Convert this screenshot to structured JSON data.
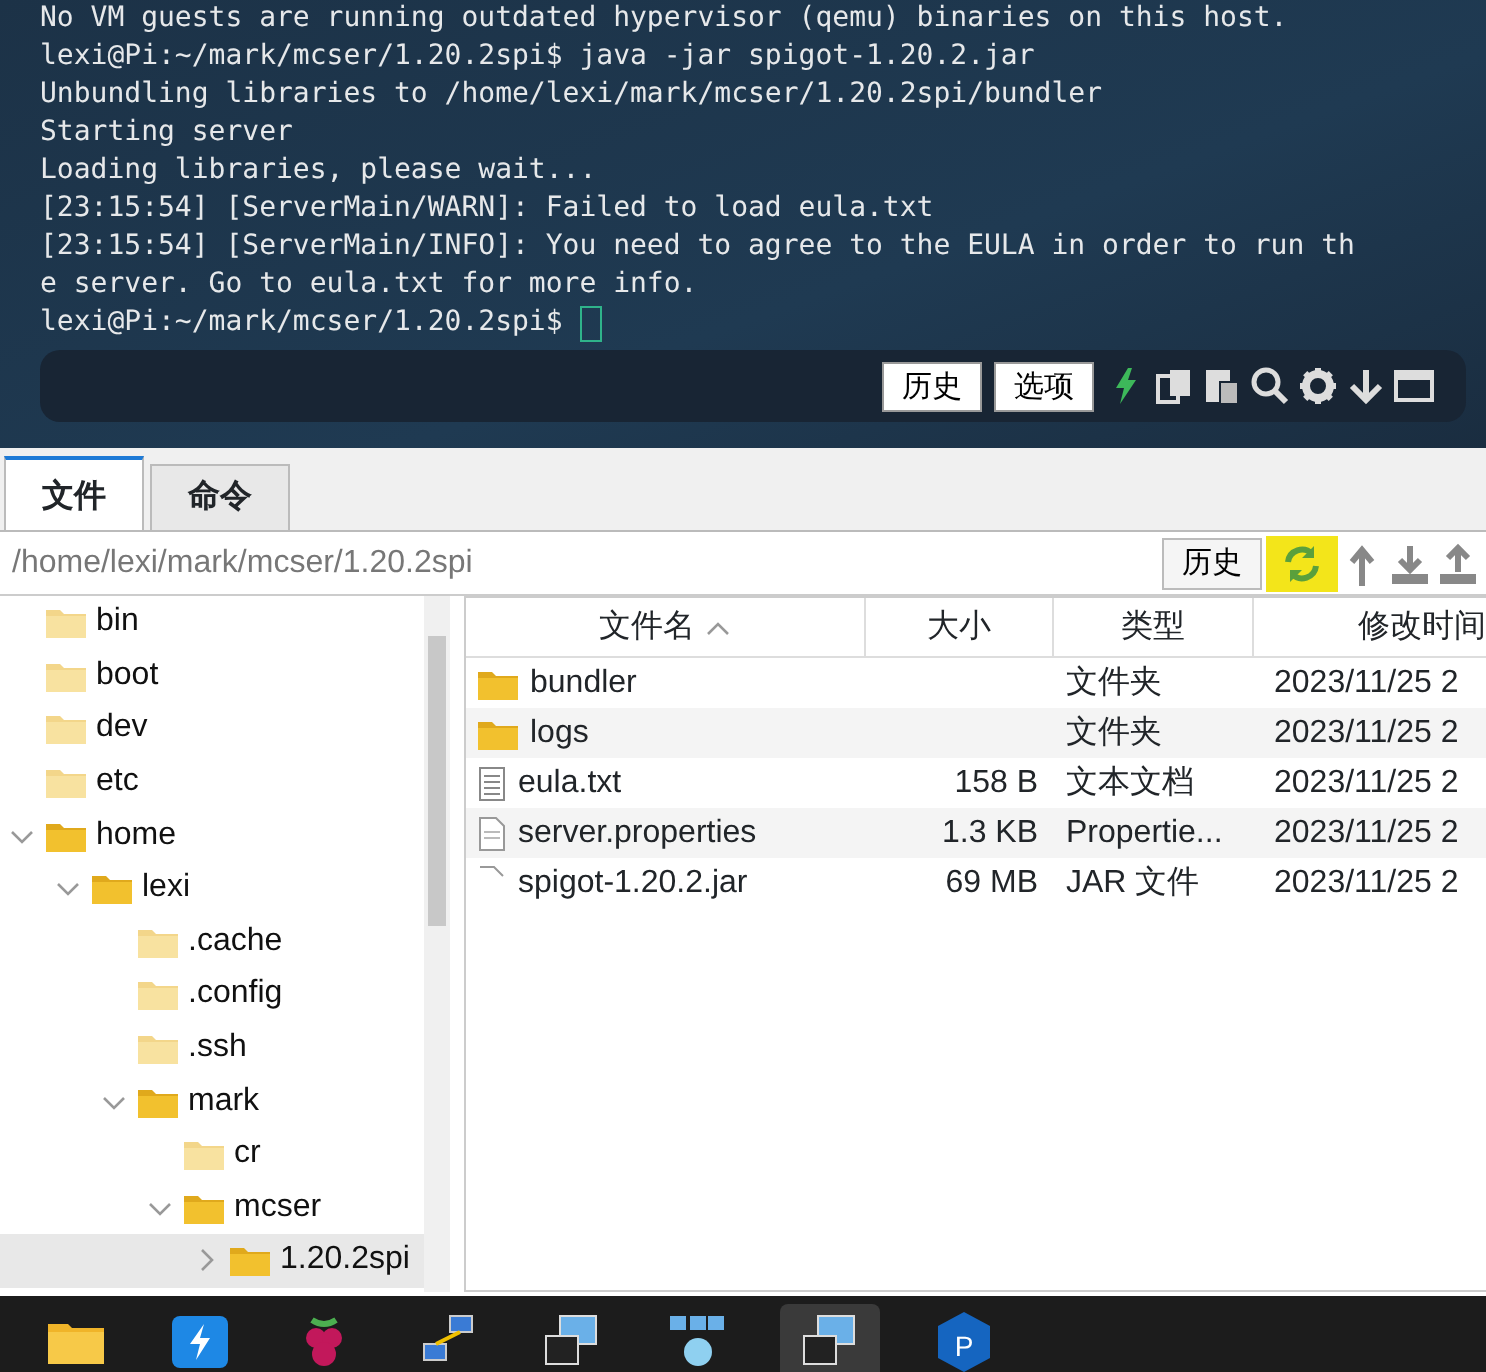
{
  "terminal": {
    "lines": [
      "No VM guests are running outdated hypervisor (qemu) binaries on this host.",
      "lexi@Pi:~/mark/mcser/1.20.2spi$ java -jar spigot-1.20.2.jar",
      "Unbundling libraries to /home/lexi/mark/mcser/1.20.2spi/bundler",
      "Starting server",
      "Loading libraries, please wait...",
      "[23:15:54] [ServerMain/WARN]: Failed to load eula.txt",
      "[23:15:54] [ServerMain/INFO]: You need to agree to the EULA in order to run th",
      "e server. Go to eula.txt for more info."
    ],
    "prompt": "lexi@Pi:~/mark/mcser/1.20.2spi$",
    "buttons": [
      "历史",
      "选项"
    ],
    "tools": [
      {
        "kind": "bolt"
      },
      {
        "kind": "copy"
      },
      {
        "kind": "paste"
      },
      {
        "kind": "search"
      },
      {
        "kind": "gear"
      },
      {
        "kind": "down"
      },
      {
        "kind": "window"
      }
    ]
  },
  "tabs": [
    {
      "label": "文件",
      "selected": true
    },
    {
      "label": "命令",
      "selected": false
    }
  ],
  "path_bar": {
    "path": "/home/lexi/mark/mcser/1.20.2spi",
    "history_button": "历史",
    "tools": [
      {
        "kind": "refresh",
        "highlighted": true
      },
      {
        "kind": "up",
        "highlighted": false
      },
      {
        "kind": "download",
        "highlighted": false
      },
      {
        "kind": "upload",
        "highlighted": false
      }
    ]
  },
  "tree": [
    {
      "label": "bin",
      "in_path": false
    },
    {
      "label": "boot",
      "in_path": false
    },
    {
      "label": "dev",
      "in_path": false
    },
    {
      "label": "etc",
      "in_path": false
    },
    {
      "label": "home",
      "in_path": true,
      "expanded": true,
      "children": [
        {
          "label": "lexi",
          "in_path": true,
          "expanded": true,
          "children": [
            {
              "label": ".cache",
              "in_path": false
            },
            {
              "label": ".config",
              "in_path": false
            },
            {
              "label": ".ssh",
              "in_path": false
            },
            {
              "label": "mark",
              "in_path": true,
              "expanded": true,
              "children": [
                {
                  "label": "cr",
                  "in_path": false
                },
                {
                  "label": "mcser",
                  "in_path": true,
                  "expanded": true,
                  "children": [
                    {
                      "label": "1.20.2spi",
                      "in_path": true,
                      "expanded": false,
                      "selected": true
                    }
                  ]
                }
              ]
            }
          ]
        }
      ]
    }
  ],
  "table": {
    "columns": [
      "文件名",
      "大小",
      "类型",
      "修改时间"
    ],
    "sort_ascending": true,
    "rows": [
      {
        "kind": "folder",
        "name": "bundler",
        "size": "",
        "type": "文件夹",
        "modified": "2023/11/25 2"
      },
      {
        "kind": "folder",
        "name": "logs",
        "size": "",
        "type": "文件夹",
        "modified": "2023/11/25 2"
      },
      {
        "kind": "text",
        "name": "eula.txt",
        "size": "158 B",
        "type": "文本文档",
        "modified": "2023/11/25 2"
      },
      {
        "kind": "doc",
        "name": "server.properties",
        "size": "1.3 KB",
        "type": "Propertie...",
        "modified": "2023/11/25 2"
      },
      {
        "kind": "file",
        "name": "spigot-1.20.2.jar",
        "size": "69 MB",
        "type": "JAR 文件",
        "modified": "2023/11/25 2"
      }
    ]
  },
  "taskbar": [
    {
      "kind": "folder",
      "active": false
    },
    {
      "kind": "bolt-app",
      "active": false
    },
    {
      "kind": "berry",
      "active": false
    },
    {
      "kind": "network",
      "active": false
    },
    {
      "kind": "monitors",
      "active": false
    },
    {
      "kind": "globe-network",
      "active": false
    },
    {
      "kind": "monitors",
      "active": true
    },
    {
      "kind": "p-app",
      "label": "P",
      "active": false
    }
  ]
}
